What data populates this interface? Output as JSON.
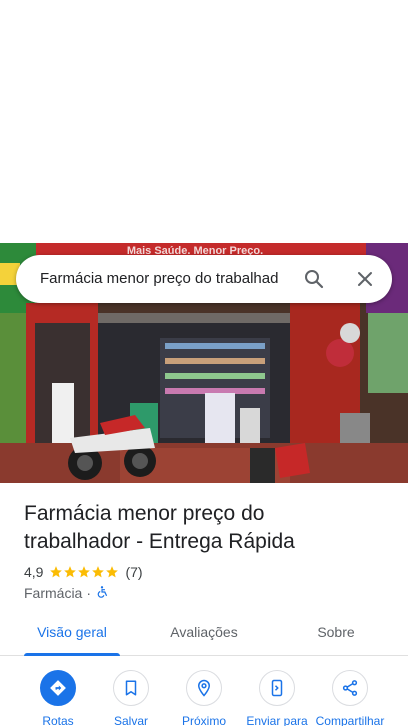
{
  "search": {
    "query": "Farmácia menor preço do trabalhad"
  },
  "photo": {
    "store_sign": "Mais Saúde. Menor Preço."
  },
  "place": {
    "title": "Farmácia menor preço do trabalhador - Entrega Rápida",
    "rating": "4,9",
    "stars": 5,
    "reviews": "(7)",
    "category": "Farmácia",
    "separator": "·"
  },
  "tabs": [
    {
      "label": "Visão geral",
      "active": true
    },
    {
      "label": "Avaliações",
      "active": false
    },
    {
      "label": "Sobre",
      "active": false
    }
  ],
  "actions": [
    {
      "label": "Rotas",
      "icon": "directions-icon"
    },
    {
      "label": "Salvar",
      "icon": "bookmark-icon"
    },
    {
      "label": "Próximo",
      "icon": "nearby-icon"
    },
    {
      "label": "Enviar para",
      "icon": "send-to-phone-icon"
    },
    {
      "label": "Compartilhar",
      "icon": "share-icon"
    }
  ],
  "colors": {
    "accent": "#1a73e8",
    "star": "#fbbc04",
    "text": "#202124",
    "muted": "#5f6368"
  }
}
